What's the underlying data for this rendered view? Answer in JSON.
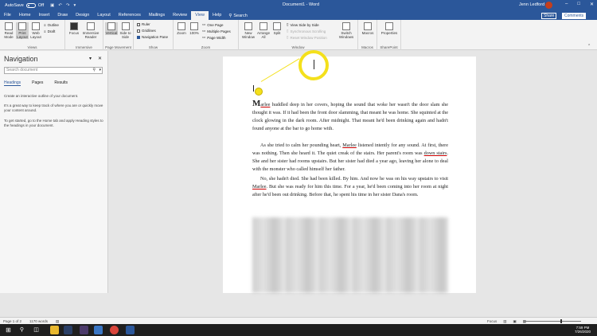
{
  "titlebar": {
    "autosave": "AutoSave",
    "autosave_state": "Off",
    "doc_title": "Document1 - Word",
    "user": "Jenn Ledford"
  },
  "menu": {
    "tabs": [
      "File",
      "Home",
      "Insert",
      "Draw",
      "Design",
      "Layout",
      "References",
      "Mailings",
      "Review",
      "View",
      "Help"
    ],
    "search": "Search",
    "share": "Share",
    "comments": "Comments"
  },
  "ribbon": {
    "views": {
      "read_mode": "Read Mode",
      "print_layout": "Print Layout",
      "web_layout": "Web Layout",
      "outline": "Outline",
      "draft": "Draft",
      "label": "Views"
    },
    "immersive": {
      "focus": "Focus",
      "reader": "Immersive Reader",
      "label": "Immersive"
    },
    "page_movement": {
      "vertical": "Vertical",
      "side": "Side to Side",
      "label": "Page Movement"
    },
    "show": {
      "ruler": "Ruler",
      "gridlines": "Gridlines",
      "nav_pane": "Navigation Pane",
      "label": "Show"
    },
    "zoom": {
      "zoom": "Zoom",
      "hundred": "100%",
      "one_page": "One Page",
      "multiple": "Multiple Pages",
      "width": "Page Width",
      "label": "Zoom"
    },
    "window": {
      "new": "New Window",
      "arrange": "Arrange All",
      "split": "Split",
      "side_by_side": "View Side by Side",
      "sync": "Synchronous Scrolling",
      "reset": "Reset Window Position",
      "switch": "Switch Windows",
      "label": "Window"
    },
    "macros": {
      "macros": "Macros",
      "label": "Macros"
    },
    "sharepoint": {
      "properties": "Properties",
      "label": "SharePoint"
    }
  },
  "navigation": {
    "title": "Navigation",
    "search_placeholder": "Search document",
    "tabs": [
      "Headings",
      "Pages",
      "Results"
    ],
    "p1": "Create an interactive outline of your document.",
    "p2": "It's a great way to keep track of where you are or quickly move your content around.",
    "p3": "To get started, go to the Home tab and apply Heading styles to the headings in your document."
  },
  "document": {
    "p1_dropcap": "M",
    "p1_word": "arlee",
    "p1_rest": " huddled deep in her covers, hoping the sound that woke her wasn't the door slam she thought it was. If it had been the front door slamming, that meant he was home. She squinted at the clock glowing in the dark room. After midnight. That meant he'd been drinking again and hadn't found anyone at the bar to go home with.",
    "p2_a": "As she tried to calm her pounding heart, ",
    "p2_name": "Marlee",
    "p2_b": " listened intently for any sound. At first, there was nothing. Then she heard it. The quiet creak of the stairs. Her parent's room was ",
    "p2_link": "down stairs",
    "p2_c": ". She and her sister had rooms upstairs. But her sister had died a year ago, leaving her alone to deal with the monster who called himself her father.",
    "p3_a": "No, she hadn't died. She had been killed. By him. And now he was on his way upstairs to visit ",
    "p3_name": "Marlee",
    "p3_b": ". But she was ready for him this time. For a year, he'd been coming into her room at night after he'd been out drinking. Before that, he spent his time in her sister Dana's room."
  },
  "statusbar": {
    "page": "Page 1 of 2",
    "words": "1170 words",
    "focus": "Focus"
  },
  "taskbar": {
    "time": "7:59 PM",
    "date": "7/26/2020"
  }
}
